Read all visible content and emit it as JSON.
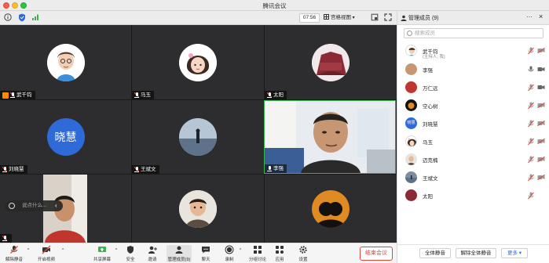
{
  "window": {
    "title": "腾讯会议"
  },
  "toolbar": {
    "timer": "07:56",
    "view_label": "宫格视图"
  },
  "tiles": [
    {
      "name": "武千钧",
      "host": true
    },
    {
      "name": "马玉"
    },
    {
      "name": "太阳"
    },
    {
      "name": "刘晓慧",
      "avatar_text": "晓慧"
    },
    {
      "name": "王斌文"
    },
    {
      "name": "李强"
    },
    {
      "name": ""
    },
    {
      "name": ""
    },
    {
      "name": ""
    }
  ],
  "chat": {
    "placeholder": "说点什么..."
  },
  "controls": {
    "mute": "解除静音",
    "video": "开启视频",
    "share": "共享屏幕",
    "security": "安全",
    "invite": "邀请",
    "members": "管理成员(9)",
    "chat": "聊天",
    "record": "录制",
    "breakout": "分组讨论",
    "apps": "应用",
    "settings": "设置",
    "end": "结束会议"
  },
  "panel": {
    "title": "管理成员 (9)",
    "search_placeholder": "搜索成员",
    "members": [
      {
        "name": "武千钧",
        "sub": "(主持人, 我)"
      },
      {
        "name": "李强"
      },
      {
        "name": "万仁远"
      },
      {
        "name": "空心树"
      },
      {
        "name": "刘晓慧",
        "avatar_text": "晓慧"
      },
      {
        "name": "马玉"
      },
      {
        "name": "迈克楠"
      },
      {
        "name": "王斌文"
      },
      {
        "name": "太阳"
      }
    ],
    "footer": {
      "mute_all": "全体静音",
      "unmute_all": "解除全体静音",
      "more": "更多"
    }
  },
  "colors": {
    "accent": "#2f6bd8",
    "danger": "#e0453d",
    "active_speaker": "#34b64a"
  }
}
